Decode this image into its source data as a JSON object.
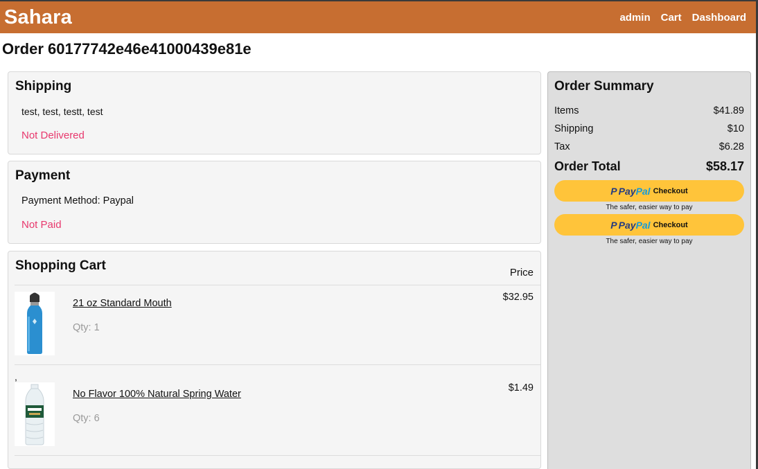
{
  "header": {
    "brand": "Sahara",
    "nav": [
      "admin",
      "Cart",
      "Dashboard"
    ]
  },
  "order": {
    "title": "Order 60177742e46e41000439e81e"
  },
  "shipping": {
    "heading": "Shipping",
    "address": "test, test, testt, test",
    "status": "Not Delivered"
  },
  "payment": {
    "heading": "Payment",
    "method": "Payment Method: Paypal",
    "status": "Not Paid"
  },
  "cart": {
    "heading": "Shopping Cart",
    "price_header": "Price",
    "stray": ",",
    "items": [
      {
        "name": "21 oz Standard Mouth",
        "qty": "Qty: 1",
        "price": "$32.95",
        "image_icon": "water-bottle-blue"
      },
      {
        "name": "No Flavor 100% Natural Spring Water",
        "qty": "Qty: 6",
        "price": "$1.49",
        "image_icon": "water-bottle-plastic"
      }
    ]
  },
  "summary": {
    "heading": "Order Summary",
    "rows": [
      {
        "label": "Items",
        "value": "$41.89"
      },
      {
        "label": "Shipping",
        "value": "$10"
      },
      {
        "label": "Tax",
        "value": "$6.28"
      }
    ],
    "total_label": "Order Total",
    "total_value": "$58.17",
    "paypal_buttons": [
      {
        "pay": "Pay",
        "pal": "Pal",
        "checkout": "Checkout",
        "tagline": "The safer, easier way to pay"
      },
      {
        "pay": "Pay",
        "pal": "Pal",
        "checkout": "Checkout",
        "tagline": "The safer, easier way to pay"
      }
    ]
  },
  "colors": {
    "header_bg": "#c76e31",
    "status_red": "#e8386d",
    "paypal_yellow": "#ffc43a",
    "paypal_dark_blue": "#253b80",
    "paypal_light_blue": "#179bd7"
  }
}
